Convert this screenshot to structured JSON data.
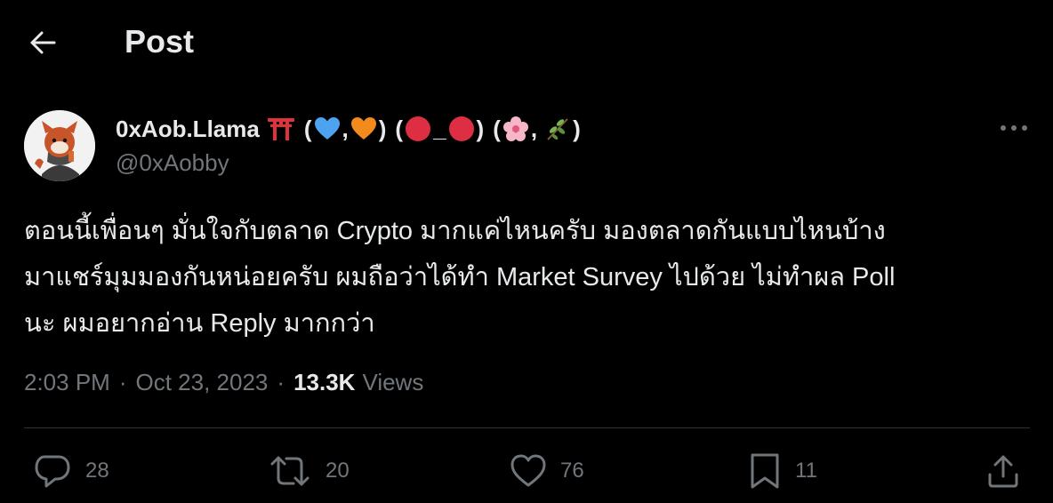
{
  "header": {
    "title": "Post",
    "back_icon": "arrow-left-icon"
  },
  "tweet": {
    "author": {
      "display_name": "0xAob.Llama",
      "handle": "@0xAobby",
      "name_symbols": [
        "torii-gate-icon",
        "blue-heart-icon",
        "orange-heart-icon",
        "red-circle-icon",
        "red-circle-icon",
        "cherry-blossom-icon",
        "herb-icon"
      ]
    },
    "text_lines": [
      "ตอนนี้เพื่อนๆ มั่นใจกับตลาด Crypto มากแค่ไหนครับ มองตลาดกันแบบไหนบ้าง",
      "มาแชร์มุมมองกันหน่อยครับ ผมถือว่าได้ทำ Market Survey ไปด้วย ไม่ทำผล Poll",
      "นะ ผมอยากอ่าน Reply มากกว่า"
    ],
    "meta": {
      "time": "2:03 PM",
      "separator": "·",
      "date": "Oct 23, 2023",
      "views_count": "13.3K",
      "views_label": "Views"
    },
    "actions": {
      "replies": "28",
      "reposts": "20",
      "likes": "76",
      "bookmarks": "11"
    }
  },
  "colors": {
    "background": "#000000",
    "text": "#e7e9ea",
    "secondary_text": "#71767b",
    "divider": "#2f3336"
  }
}
